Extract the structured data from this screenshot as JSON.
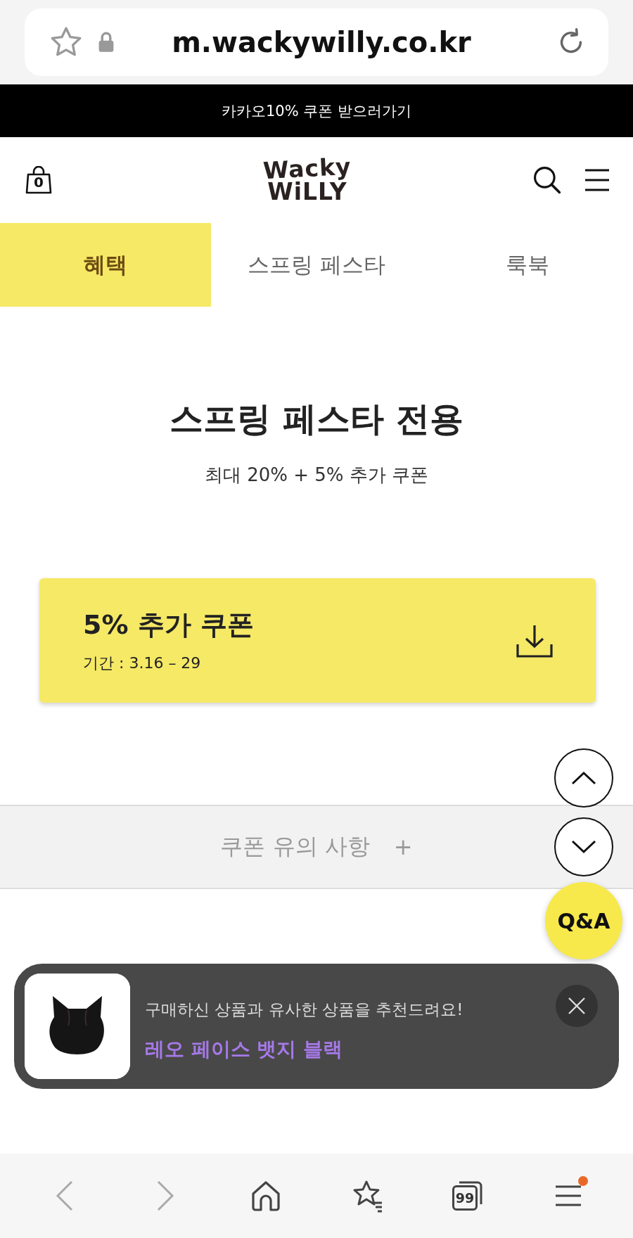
{
  "browser": {
    "url": "m.wackywilly.co.kr"
  },
  "promo_bar": {
    "text": "카카오10% 쿠폰 받으러가기"
  },
  "header": {
    "logo": [
      "Wacky",
      "WiLLY"
    ],
    "cart_count": "0"
  },
  "tabs": [
    {
      "label": "혜택",
      "selected": true
    },
    {
      "label": "스프링 페스타",
      "selected": false
    },
    {
      "label": "룩북",
      "selected": false
    }
  ],
  "hero": {
    "title": "스프링 페스타 전용",
    "subtitle": "최대 20% + 5% 추가 쿠폰"
  },
  "coupon": {
    "title": "5% 추가 쿠폰",
    "period": "기간 : 3.16 – 29"
  },
  "notice": {
    "label": "쿠폰 유의 사항",
    "toggle": "+"
  },
  "qa_button": "Q&A",
  "toast": {
    "message": "구매하신 상품과 유사한 상품을 추천드려요!",
    "product": "레오 페이스 뱃지 블랙"
  },
  "bottom_nav": {
    "tab_count": "99",
    "menu_badge": true
  }
}
